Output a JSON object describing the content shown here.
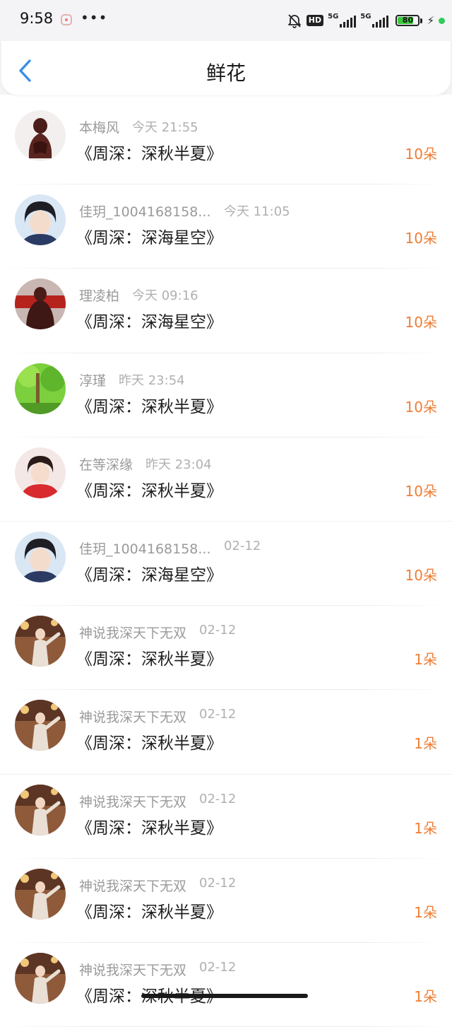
{
  "status_bar": {
    "time": "9:58",
    "more": "•••",
    "hd": "HD",
    "network_1": "5G",
    "network_2": "5G",
    "battery_percent": 80,
    "battery_text": "80"
  },
  "header": {
    "title": "鲜花"
  },
  "colors": {
    "accent_blue": "#3a8ee6",
    "count_orange": "#f07d34"
  },
  "records": [
    {
      "user": "本梅风",
      "time": "今天 21:55",
      "title": "《周深：深秋半夏》",
      "count": "10朵",
      "avatar": "figurine-avatar"
    },
    {
      "user": "佳玥_1004168158...",
      "time": "今天 11:05",
      "title": "《周深：深海星空》",
      "count": "10朵",
      "avatar": "portrait-avatar"
    },
    {
      "user": "理凌柏",
      "time": "今天 09:16",
      "title": "《周深：深海星空》",
      "count": "10朵",
      "avatar": "red-figurine-avatar"
    },
    {
      "user": "淳瑾",
      "time": "昨天 23:54",
      "title": "《周深：深秋半夏》",
      "count": "10朵",
      "avatar": "green-forest-avatar"
    },
    {
      "user": "在等深缘",
      "time": "昨天 23:04",
      "title": "《周深：深秋半夏》",
      "count": "10朵",
      "avatar": "red-sweater-avatar"
    },
    {
      "user": "佳玥_1004168158...",
      "time": "02-12",
      "title": "《周深：深海星空》",
      "count": "10朵",
      "avatar": "portrait-avatar"
    },
    {
      "user": "神说我深天下无双",
      "time": "02-12",
      "title": "《周深：深秋半夏》",
      "count": "1朵",
      "avatar": "stage-avatar"
    },
    {
      "user": "神说我深天下无双",
      "time": "02-12",
      "title": "《周深：深秋半夏》",
      "count": "1朵",
      "avatar": "stage-avatar"
    },
    {
      "user": "神说我深天下无双",
      "time": "02-12",
      "title": "《周深：深秋半夏》",
      "count": "1朵",
      "avatar": "stage-avatar"
    },
    {
      "user": "神说我深天下无双",
      "time": "02-12",
      "title": "《周深：深秋半夏》",
      "count": "1朵",
      "avatar": "stage-avatar"
    },
    {
      "user": "神说我深天下无双",
      "time": "02-12",
      "title": "《周深：深秋半夏》",
      "count": "1朵",
      "avatar": "stage-avatar"
    }
  ]
}
